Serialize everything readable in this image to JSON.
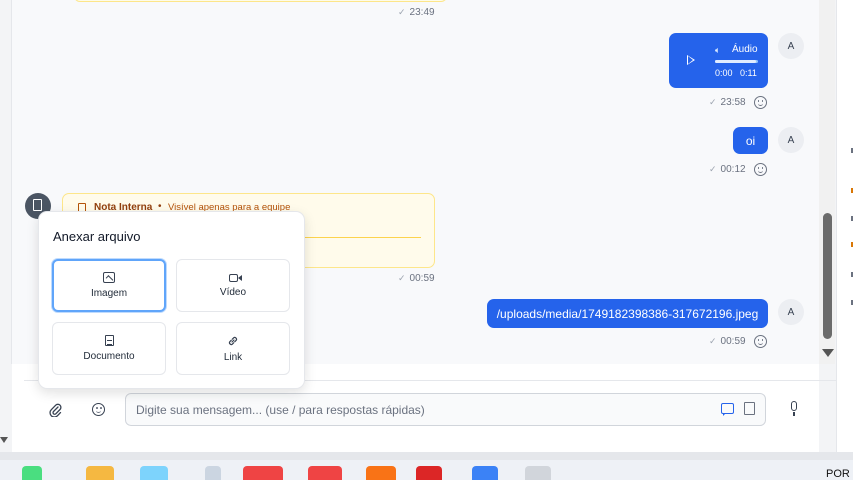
{
  "messages": {
    "top_time": "23:49",
    "audio": {
      "label": "Áudio",
      "current": "0:00",
      "duration": "0:11",
      "progress": 0.95,
      "time": "23:58",
      "avatar": "A"
    },
    "oi": {
      "text": "oi",
      "time": "00:12",
      "avatar": "A"
    },
    "note": {
      "title": "Nota Interna",
      "separator": "•",
      "subtitle": "Visível apenas para a equipe",
      "time": "00:59"
    },
    "jpeg": {
      "text": "/uploads/media/1749182398386-317672196.jpeg",
      "time": "00:59",
      "avatar": "A"
    }
  },
  "attach_popup": {
    "title": "Anexar arquivo",
    "options": [
      {
        "label": "Imagem",
        "icon": "image-icon"
      },
      {
        "label": "Vídeo",
        "icon": "video-icon"
      },
      {
        "label": "Documento",
        "icon": "document-icon"
      },
      {
        "label": "Link",
        "icon": "link-icon"
      }
    ]
  },
  "composer": {
    "placeholder": "Digite sua mensagem... (use / para respostas rápidas)"
  },
  "taskbar": {
    "clock_fragment": "POR"
  },
  "colors": {
    "accent": "#2563eb",
    "note_bg": "#fffbeb",
    "note_border": "#fde68a",
    "note_title": "#92400e"
  }
}
